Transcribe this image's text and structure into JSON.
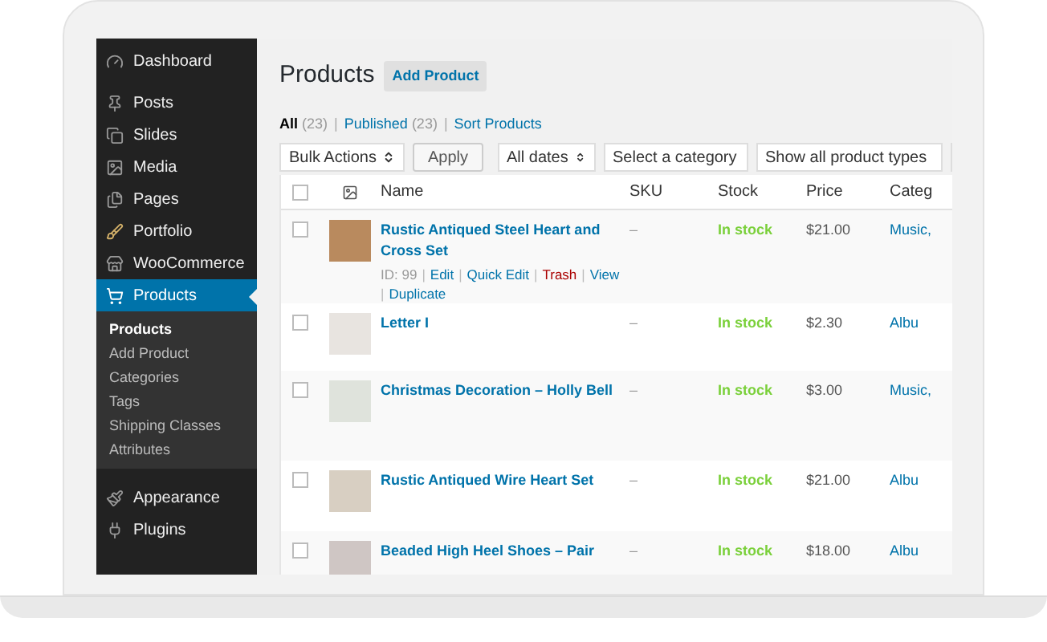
{
  "sidebar": {
    "items": [
      {
        "label": "Dashboard",
        "selected": false
      },
      {
        "label": "Posts",
        "selected": false
      },
      {
        "label": "Slides",
        "selected": false
      },
      {
        "label": "Media",
        "selected": false
      },
      {
        "label": "Pages",
        "selected": false
      },
      {
        "label": "Portfolio",
        "selected": false
      },
      {
        "label": "WooCommerce",
        "selected": false
      },
      {
        "label": "Products",
        "selected": true,
        "children": [
          {
            "label": "Products",
            "selected": true
          },
          {
            "label": "Add Product",
            "selected": false
          },
          {
            "label": "Categories",
            "selected": false
          },
          {
            "label": "Tags",
            "selected": false
          },
          {
            "label": "Shipping Classes",
            "selected": false
          },
          {
            "label": "Attributes",
            "selected": false
          }
        ]
      },
      {
        "label": "Appearance",
        "selected": false
      },
      {
        "label": "Plugins",
        "selected": false
      }
    ]
  },
  "page": {
    "title": "Products",
    "add_button": "Add Product"
  },
  "filters": {
    "separator": "|",
    "items": [
      {
        "label": "All",
        "count": "(23)",
        "selected": true
      },
      {
        "label": "Published",
        "count": "(23)",
        "selected": false
      },
      {
        "label": "Sort Products",
        "selected": false
      }
    ]
  },
  "toolbar": {
    "bulk_actions": "Bulk Actions",
    "apply": "Apply",
    "dates": "All dates",
    "category": "Select a category",
    "product_type": "Show all product types"
  },
  "table": {
    "select_all_checked": false,
    "columns": [
      "Name",
      "SKU",
      "Stock",
      "Price",
      "Categ"
    ],
    "rows": [
      {
        "name": "Rustic Antiqued Steel Heart and Cross Set",
        "sku": "–",
        "stock": "In stock",
        "price": "$21.00",
        "category": "Music,",
        "checked": false,
        "separator": "|",
        "actions": [
          {
            "text": "ID: 99",
            "kind": "meta"
          },
          {
            "text": "Edit",
            "kind": "link"
          },
          {
            "text": "Quick Edit",
            "kind": "link"
          },
          {
            "text": "Trash",
            "kind": "danger"
          },
          {
            "text": "View",
            "kind": "link"
          },
          {
            "text": "Duplicate",
            "kind": "link"
          }
        ]
      },
      {
        "name": "Letter I",
        "sku": "–",
        "stock": "In stock",
        "price": "$2.30",
        "category": "Albu",
        "checked": false
      },
      {
        "name": "Christmas Decoration – Holly Bell",
        "sku": "–",
        "stock": "In stock",
        "price": "$3.00",
        "category": "Music,",
        "checked": false
      },
      {
        "name": "Rustic Antiqued Wire Heart Set",
        "sku": "–",
        "stock": "In stock",
        "price": "$21.00",
        "category": "Albu",
        "checked": false
      },
      {
        "name": "Beaded High Heel Shoes – Pair",
        "sku": "–",
        "stock": "In stock",
        "price": "$18.00",
        "category": "Albu",
        "checked": false
      }
    ]
  }
}
